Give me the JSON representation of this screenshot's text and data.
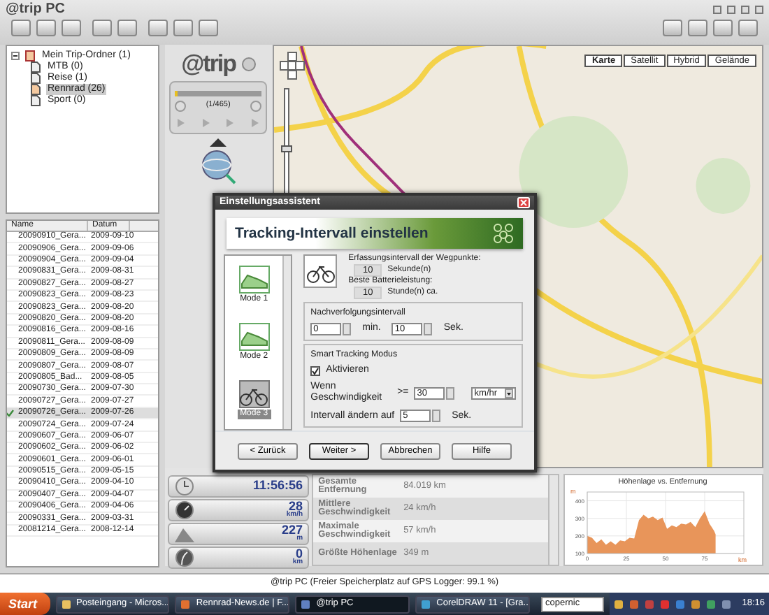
{
  "window": {
    "title": "@trip PC"
  },
  "tree": {
    "label": "Mein Trip-Ordner (1)",
    "expanded": true,
    "children": [
      {
        "label": "MTB (0)",
        "selected": false
      },
      {
        "label": "Reise (1)",
        "selected": false
      },
      {
        "label": "Rennrad (26)",
        "selected": true
      },
      {
        "label": "Sport (0)",
        "selected": false
      }
    ]
  },
  "track_list": {
    "columns": [
      "Name",
      "Datum"
    ],
    "rows": [
      {
        "name": "20090910_Gera...",
        "date": "2009-09-10",
        "checked": false
      },
      {
        "name": "20090906_Gera...",
        "date": "2009-09-06",
        "checked": false
      },
      {
        "name": "20090904_Gera...",
        "date": "2009-09-04",
        "checked": false
      },
      {
        "name": "20090831_Gera...",
        "date": "2009-08-31",
        "checked": false
      },
      {
        "name": "20090827_Gera...",
        "date": "2009-08-27",
        "checked": false
      },
      {
        "name": "20090823_Gera...",
        "date": "2009-08-23",
        "checked": false
      },
      {
        "name": "20090823_Gera...",
        "date": "2009-08-20",
        "checked": false
      },
      {
        "name": "20090820_Gera...",
        "date": "2009-08-20",
        "checked": false
      },
      {
        "name": "20090816_Gera...",
        "date": "2009-08-16",
        "checked": false
      },
      {
        "name": "20090811_Gera...",
        "date": "2009-08-09",
        "checked": false
      },
      {
        "name": "20090809_Gera...",
        "date": "2009-08-09",
        "checked": false
      },
      {
        "name": "20090807_Gera...",
        "date": "2009-08-07",
        "checked": false
      },
      {
        "name": "20090805_Bad...",
        "date": "2009-08-05",
        "checked": false
      },
      {
        "name": "20090730_Gera...",
        "date": "2009-07-30",
        "checked": false
      },
      {
        "name": "20090727_Gera...",
        "date": "2009-07-27",
        "checked": false
      },
      {
        "name": "20090726_Gera...",
        "date": "2009-07-26",
        "checked": true
      },
      {
        "name": "20090724_Gera...",
        "date": "2009-07-24",
        "checked": false
      },
      {
        "name": "20090607_Gera...",
        "date": "2009-06-07",
        "checked": false
      },
      {
        "name": "20090602_Gera...",
        "date": "2009-06-02",
        "checked": false
      },
      {
        "name": "20090601_Gera...",
        "date": "2009-06-01",
        "checked": false
      },
      {
        "name": "20090515_Gera...",
        "date": "2009-05-15",
        "checked": false
      },
      {
        "name": "20090410_Gera...",
        "date": "2009-04-10",
        "checked": false
      },
      {
        "name": "20090407_Gera...",
        "date": "2009-04-07",
        "checked": false
      },
      {
        "name": "20090406_Gera...",
        "date": "2009-04-06",
        "checked": false
      },
      {
        "name": "20090331_Gera...",
        "date": "2009-03-31",
        "checked": false
      },
      {
        "name": "20081214_Gera...",
        "date": "2008-12-14",
        "checked": false
      }
    ]
  },
  "side_panel": {
    "logo": "@trip",
    "player": {
      "counter": "(1/465)",
      "level": 0.03
    }
  },
  "map": {
    "zoom": {
      "level": 0.62
    },
    "map_types": [
      {
        "label": "Karte",
        "selected": true
      },
      {
        "label": "Satellit",
        "selected": false
      },
      {
        "label": "Hybrid",
        "selected": false
      },
      {
        "label": "Gelände",
        "selected": false
      }
    ]
  },
  "dialog": {
    "title": "Einstellungsassistent",
    "heading": "Tracking-Intervall einstellen",
    "modes": [
      {
        "label": "Mode 1",
        "kind": "shoe",
        "selected": false
      },
      {
        "label": "Mode 2",
        "kind": "shoe",
        "selected": false
      },
      {
        "label": "Mode 3",
        "kind": "bicycle",
        "selected": true
      }
    ],
    "capture_label": "Erfassungsintervall der Wegpunkte:",
    "capture_value": "10",
    "capture_unit": "Sekunde(n)",
    "battery_label": "Beste Batterieleistung:",
    "battery_value": "10",
    "battery_unit": "Stunde(n) ca.",
    "tracking_group": {
      "title": "Nachverfolgungsintervall",
      "minutes": "0",
      "minutes_unit": "min.",
      "seconds": "10",
      "seconds_unit": "Sek."
    },
    "smart_group": {
      "title": "Smart Tracking Modus",
      "enable_label": "Aktivieren",
      "checked": true,
      "speed_label": "Wenn Geschwindigkeit",
      "operator": ">=",
      "speed": "30",
      "speed_unit": "km/hr",
      "change_label": "Intervall ändern auf",
      "interval": "5",
      "interval_unit": "Sek."
    },
    "buttons": [
      {
        "label": "< Zurück",
        "default": false
      },
      {
        "label": "Weiter >",
        "default": true
      },
      {
        "label": "Abbrechen",
        "default": false
      },
      {
        "label": "Hilfe",
        "default": false
      }
    ]
  },
  "stats": {
    "gauges": [
      {
        "kind": "clock",
        "value": "11:56:56"
      },
      {
        "kind": "speed",
        "value": "28",
        "unit": "km/h"
      },
      {
        "kind": "mountain",
        "value": "227",
        "unit": "m"
      },
      {
        "kind": "road",
        "value": "0",
        "unit": "km"
      }
    ],
    "rows": [
      {
        "label": "Gesamte Entfernung",
        "value": "84.019 km"
      },
      {
        "label": "Mittlere Geschwindigkeit",
        "value": "24 km/h"
      },
      {
        "label": "Maximale Geschwindigkeit",
        "value": "57 km/h"
      },
      {
        "label": "Größte Höhenlage",
        "value": "349 m"
      }
    ]
  },
  "elevation_chart": {
    "chart_data": {
      "type": "area",
      "title": "Höhenlage vs. Entfernung",
      "xlabel": "km",
      "ylabel": "m",
      "xlim": [
        0,
        100
      ],
      "ylim": [
        100,
        450
      ],
      "xticks": [
        0,
        25,
        50,
        75
      ],
      "yticks": [
        100,
        200,
        300,
        400
      ],
      "grid": true,
      "x": [
        0,
        3,
        6,
        9,
        12,
        15,
        18,
        21,
        24,
        27,
        30,
        33,
        36,
        39,
        42,
        45,
        48,
        51,
        54,
        57,
        60,
        63,
        66,
        69,
        72,
        75,
        78,
        81,
        82
      ],
      "series": [
        {
          "color": "#e8955a",
          "values": [
            200,
            190,
            160,
            180,
            150,
            170,
            150,
            175,
            170,
            190,
            185,
            290,
            320,
            300,
            310,
            290,
            305,
            240,
            260,
            250,
            270,
            265,
            280,
            250,
            300,
            340,
            270,
            230,
            210
          ]
        }
      ]
    }
  },
  "status_bar": "@trip PC (Freier Speicherplatz auf GPS Logger: 99.1 %)",
  "taskbar": {
    "start": "Start",
    "tasks": [
      {
        "label": "Posteingang - Micros...",
        "kind": "mail",
        "selected": false
      },
      {
        "label": "Rennrad-News.de | F...",
        "kind": "browser",
        "selected": false
      },
      {
        "label": "@trip PC",
        "kind": "app",
        "selected": true
      },
      {
        "label": "CorelDRAW 11 - [Gra...",
        "kind": "draw",
        "selected": false
      }
    ],
    "search": "copernic",
    "clock": "18:16"
  }
}
